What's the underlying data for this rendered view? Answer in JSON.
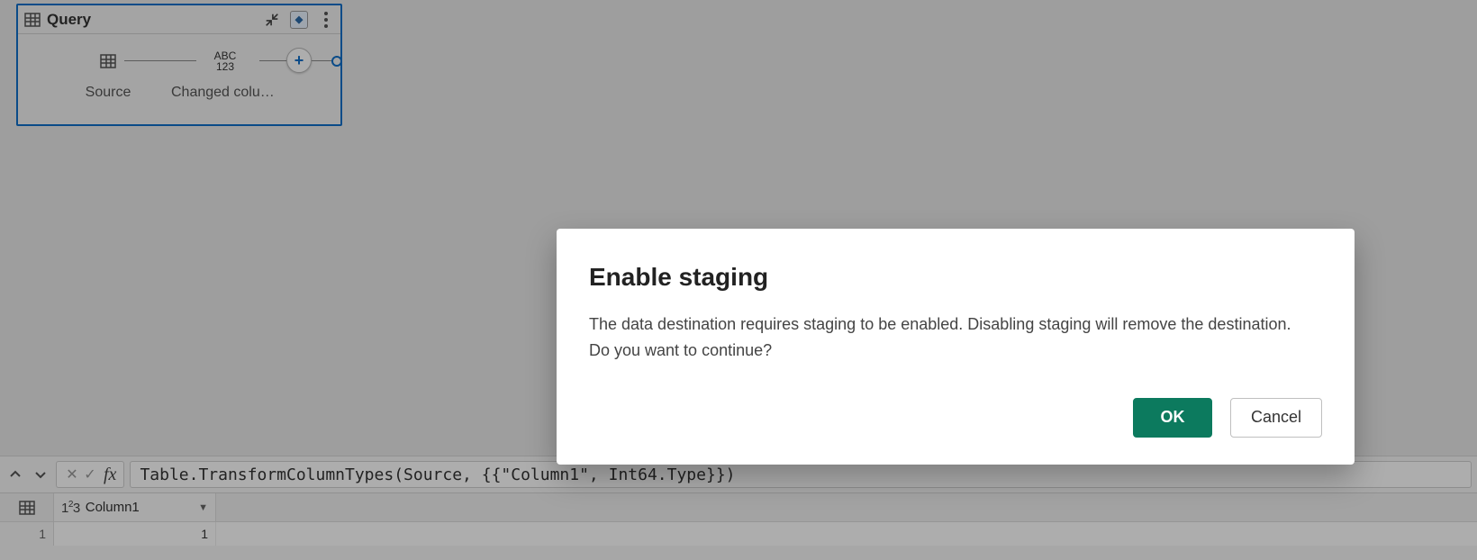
{
  "node": {
    "title": "Query",
    "steps": [
      {
        "label": "Source"
      },
      {
        "label": "Changed column…",
        "icon_top": "ABC",
        "icon_bottom": "123"
      }
    ]
  },
  "formula": {
    "text": "Table.TransformColumnTypes(Source, {{\"Column1\", Int64.Type}})"
  },
  "grid": {
    "col_type_label": "1²3",
    "col_name": "Column1",
    "rows": [
      {
        "n": "1",
        "v": "1"
      }
    ]
  },
  "dialog": {
    "title": "Enable staging",
    "body": "The data destination requires staging to be enabled. Disabling staging will remove the destination. Do you want to continue?",
    "ok": "OK",
    "cancel": "Cancel"
  }
}
